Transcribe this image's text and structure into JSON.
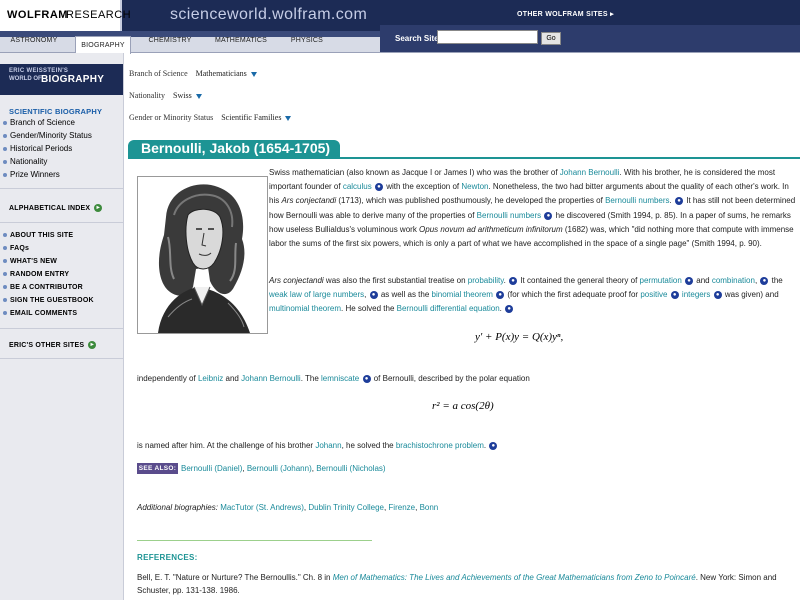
{
  "header": {
    "brand_bold": "WOLFRAM",
    "brand_light": "RESEARCH",
    "site_title": "scienceworld.wolfram.com",
    "other_sites": "OTHER WOLFRAM SITES ▸",
    "search_label": "Search Site",
    "search_value": "",
    "go_label": "Go"
  },
  "nav": {
    "tabs": [
      {
        "label": "ASTRONOMY"
      },
      {
        "label": "BIOGRAPHY"
      },
      {
        "label": "CHEMISTRY"
      },
      {
        "label": "MATHEMATICS"
      },
      {
        "label": "PHYSICS"
      }
    ],
    "active": "BIOGRAPHY"
  },
  "sidebar": {
    "logo_line1": "ERIC WEISSTEIN'S",
    "logo_line2": "WORLD OF",
    "logo_line3": "BIOGRAPHY",
    "section_title": "SCIENTIFIC BIOGRAPHY",
    "items": [
      {
        "label": "Branch of Science"
      },
      {
        "label": "Gender/Minority Status"
      },
      {
        "label": "Historical Periods"
      },
      {
        "label": "Nationality"
      },
      {
        "label": "Prize Winners"
      }
    ],
    "alpha_index": "ALPHABETICAL INDEX",
    "links": [
      {
        "label": "ABOUT THIS SITE"
      },
      {
        "label": "FAQs"
      },
      {
        "label": "WHAT'S NEW"
      },
      {
        "label": "RANDOM ENTRY"
      },
      {
        "label": "BE A CONTRIBUTOR"
      },
      {
        "label": "SIGN THE GUESTBOOK"
      },
      {
        "label": "EMAIL COMMENTS"
      }
    ],
    "other_sites": "ERIC'S OTHER SITES"
  },
  "filters": [
    {
      "label": "Branch of Science",
      "value": "Mathematicians"
    },
    {
      "label": "Nationality",
      "value": "Swiss"
    },
    {
      "label": "Gender or Minority Status",
      "value": "Scientific Families"
    }
  ],
  "article": {
    "title": "Bernoulli, Jakob (1654-1705)",
    "p1": {
      "t1": "Swiss mathematician (also known as Jacque I or James I) who was the brother of ",
      "l1": "Johann Bernoulli",
      "t2": ". With his brother, he is considered the most important founder of ",
      "l2": "calculus",
      "t3": " with the exception of ",
      "l3": "Newton",
      "t4": ". Nonetheless, the two had bitter arguments about the quality of each other's work. In his ",
      "i1": "Ars conjectandi",
      "t5": " (1713), which was published posthumously, he developed the properties of ",
      "l4": "Bernoulli numbers",
      "t6": ". ",
      "t7": " It has still not been determined how Bernoulli was able to derive many of the properties of ",
      "l5": "Bernoulli numbers",
      "t8": " he discovered (Smith 1994, p. 85). In a paper of sums, he remarks how useless Bullialdus's voluminous work ",
      "i2": "Opus novum ad arithmeticum infinitorum",
      "t9": " (1682) was, which \"did nothing more that compute with immense labor the sums of the first six powers, which is only a part of what we have accomplished in the space of a single page\" (Smith 1994, p. 90)."
    },
    "p2": {
      "i1": "Ars conjectandi",
      "t1": " was also the first substantial treatise on ",
      "l1": "probability",
      "t2": ". ",
      "t3": " It contained the general theory of ",
      "l2": "permutation",
      "t4": " and ",
      "l3": "combination",
      "t5": ", ",
      "t6": " the ",
      "l4": "weak law of large numbers",
      "t7": ", ",
      "t8": " as well as the ",
      "l5": "binomial theorem",
      "t9": " (for which the first adequate proof for ",
      "l6": "positive",
      "l7": "integers",
      "t10": " was given) and ",
      "l8": "multinomial theorem",
      "t11": ". He solved the ",
      "l9": "Bernoulli differential equation",
      "t12": "."
    },
    "eq1": "y′ + P(x)y = Q(x)yⁿ,",
    "p3": {
      "t1": "independently of ",
      "l1": "Leibniz",
      "t2": " and ",
      "l2": "Johann Bernoulli",
      "t3": ". The ",
      "l3": "lemniscate",
      "t4": " of Bernoulli, described by the polar equation"
    },
    "eq2": "r² = a cos(2θ)",
    "p4": {
      "t1": "is named after him. At the challenge of his brother ",
      "l1": "Johann",
      "t2": ", he solved the ",
      "l2": "brachistochrone problem",
      "t3": "."
    },
    "see_also_label": "SEE ALSO:",
    "see_also": {
      "l1": "Bernoulli (Daniel)",
      "l2": "Bernoulli (Johann)",
      "l3": "Bernoulli (Nicholas)"
    },
    "additional": {
      "label": "Additional biographies:",
      "l1": "MacTutor (St. Andrews)",
      "l2": "Dublin Trinity College",
      "l3": "Firenze",
      "l4": "Bonn"
    },
    "references_label": "REFERENCES:",
    "reference": {
      "t1": "Bell, E. T. \"Nature or Nurture? The Bernoullis.\" Ch. 8 in ",
      "l1": "Men of Mathematics: The Lives and Achievements of the Great Mathematicians from Zeno to Poincaré",
      "t2": ". New York: Simon and Schuster, pp. 131-138. 1986."
    }
  },
  "icons": {
    "info": "mathworld-info-icon"
  }
}
